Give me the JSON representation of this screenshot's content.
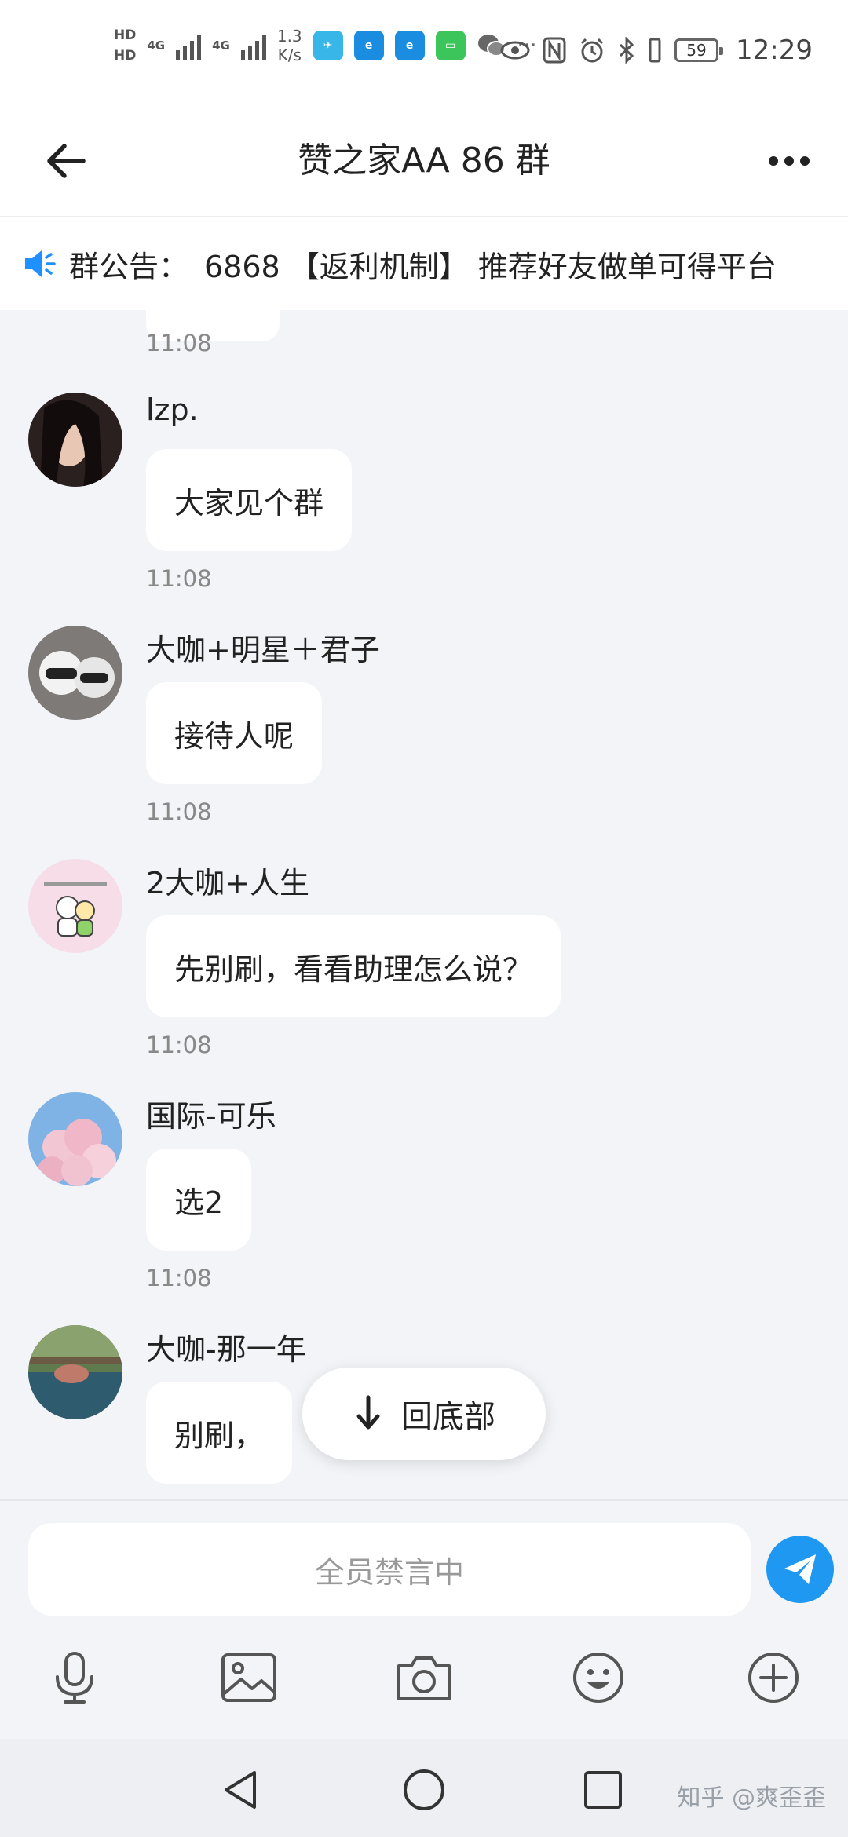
{
  "status_bar": {
    "hd1": "HD",
    "hd2": "HD",
    "net1": "4G",
    "net2": "4G",
    "speed_value": "1.3",
    "speed_unit": "K/s",
    "battery": "59",
    "time": "12:29",
    "more_dots": "···"
  },
  "header": {
    "title": "赞之家AA 86 群"
  },
  "announcement": {
    "label": "群公告：",
    "text": "6868 【返利机制】 推荐好友做单可得平台"
  },
  "chat": {
    "top_timestamp": "11:08",
    "messages": [
      {
        "name": "lzp.",
        "text": "大家见个群",
        "time": "11:08"
      },
      {
        "name": "大咖+明星＋君子",
        "text": "接待人呢",
        "time": "11:08"
      },
      {
        "name": "2大咖+人生",
        "text": "先别刷，看看助理怎么说？",
        "time": "11:08"
      },
      {
        "name": "国际-可乐",
        "text": "选2",
        "time": "11:08"
      },
      {
        "name": "大咖-那一年",
        "text": "别刷，"
      }
    ]
  },
  "scroll_to_bottom": {
    "label": "回底部"
  },
  "input": {
    "placeholder": "全员禁言中"
  },
  "watermark": "知乎 @爽歪歪",
  "colors": {
    "send_button": "#1e98f0",
    "background": "#f3f4f8"
  }
}
